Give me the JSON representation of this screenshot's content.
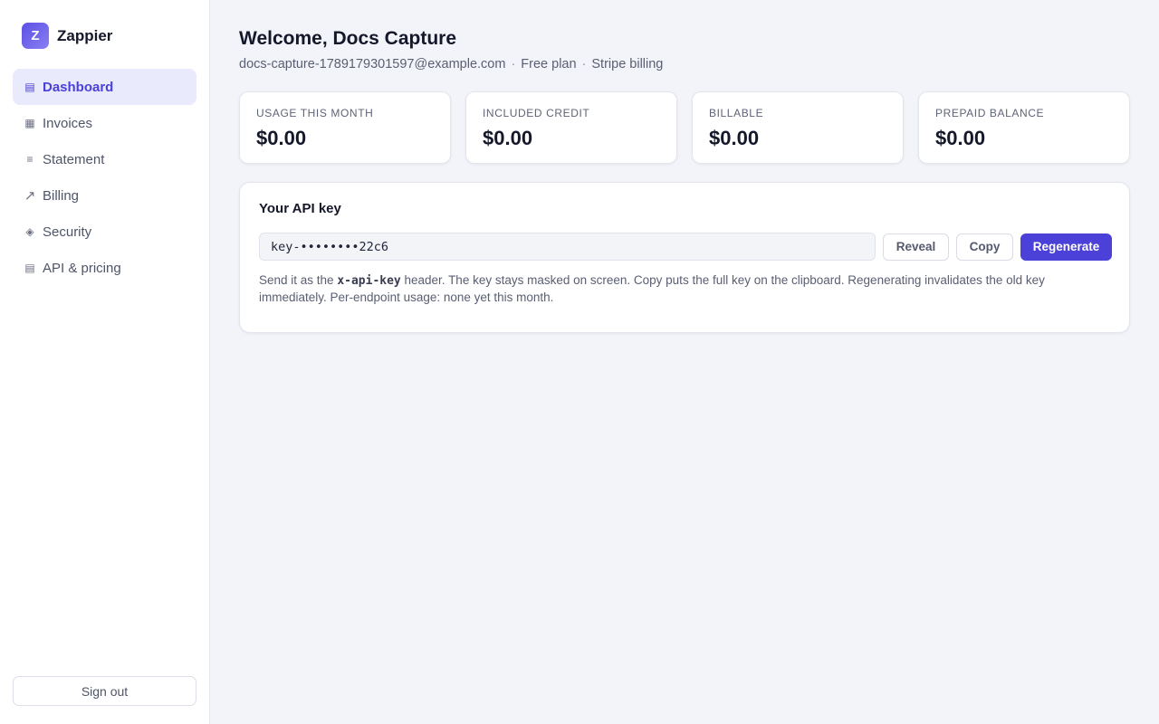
{
  "brand": {
    "logo_letter": "Z",
    "name": "Zappier",
    "accent": "#4b40d8"
  },
  "sidebar": {
    "items": [
      {
        "label": "Dashboard",
        "icon": "dashboard-icon",
        "glyph": "▤",
        "active": true
      },
      {
        "label": "Invoices",
        "icon": "grid-icon",
        "glyph": "▦",
        "active": false
      },
      {
        "label": "Statement",
        "icon": "list-icon",
        "glyph": "≡",
        "active": false
      },
      {
        "label": "Billing",
        "icon": "arrow-up-right-icon",
        "glyph": "↗",
        "active": false
      },
      {
        "label": "Security",
        "icon": "diamond-icon",
        "glyph": "◈",
        "active": false
      },
      {
        "label": "API & pricing",
        "icon": "document-icon",
        "glyph": "▤",
        "active": false
      }
    ],
    "signout_label": "Sign out"
  },
  "header": {
    "title": "Welcome, Docs Capture",
    "email": "docs-capture-1789179301597@example.com",
    "plan": "Free plan",
    "billing": "Stripe billing",
    "separator": "·"
  },
  "stats": [
    {
      "label": "USAGE THIS MONTH",
      "value": "$0.00"
    },
    {
      "label": "INCLUDED CREDIT",
      "value": "$0.00"
    },
    {
      "label": "BILLABLE",
      "value": "$0.00"
    },
    {
      "label": "PREPAID BALANCE",
      "value": "$0.00"
    }
  ],
  "api_key": {
    "title": "Your API key",
    "masked_value": "key-••••••••22c6",
    "reveal_label": "Reveal",
    "copy_label": "Copy",
    "regenerate_label": "Regenerate",
    "note_prefix": "Send it as the ",
    "note_code": "x-api-key",
    "note_suffix": " header. The key stays masked on screen. Copy puts the full key on the clipboard. Regenerating invalidates the old key immediately. Per-endpoint usage: none yet this month."
  }
}
